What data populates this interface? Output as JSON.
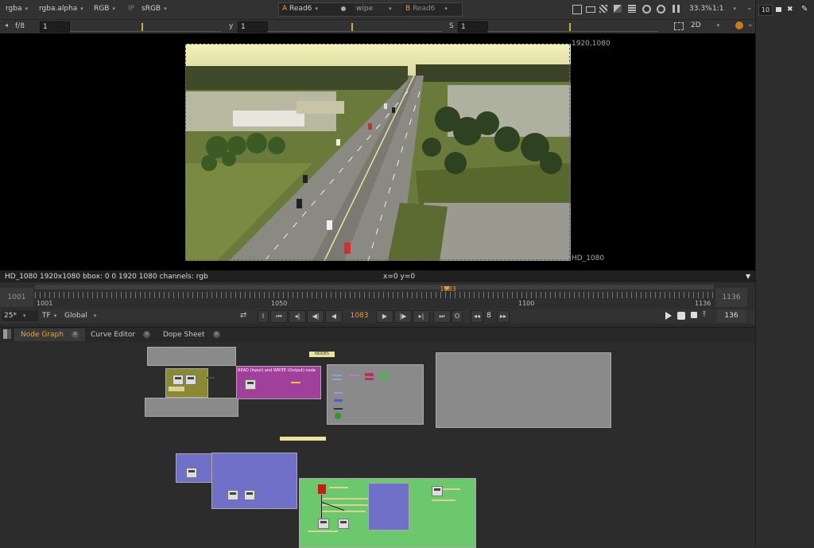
{
  "viewer_toolbar": {
    "channels": "rgba",
    "alpha": "rgba.alpha",
    "display": "RGB",
    "ip": "IP",
    "lut": "sRGB",
    "a_label": "A",
    "a_input": "Read6",
    "wipe_mode": "wipe",
    "b_label": "B",
    "b_input": "Read6",
    "zoom": "33.3%",
    "ratio": "1:1"
  },
  "viewer_toolbar2": {
    "fstop": "f/8",
    "gain": "1",
    "gamma_label": "y",
    "gamma": "1",
    "sat_label": "S",
    "sat": "1",
    "view_mode": "2D",
    "gain_ticks": [
      "0.0625",
      "0.1",
      "0.3",
      "1",
      "3",
      "6",
      "16",
      "64"
    ],
    "gamma_ticks": [
      "0",
      "0.1",
      "0.4",
      "0.5",
      "1",
      "2",
      "4"
    ],
    "sat_ticks": [
      "0",
      "0.1",
      "0.4",
      "0.5",
      "1",
      "2",
      "4"
    ]
  },
  "viewer": {
    "format_top_right": "1920,1080",
    "format_bottom_right": "HD_1080",
    "info_left": "HD_1080 1920x1080  bbox: 0 0 1920 1080 channels: rgb",
    "coords": "x=0 y=0"
  },
  "timeline": {
    "start_frame": "1001",
    "end_frame": "1136",
    "current_frame": "1083",
    "tick_labels": [
      "1001",
      "1050",
      "1100",
      "1136"
    ],
    "current_marker": 0.607
  },
  "playback": {
    "fps": "25*",
    "tf": "TF",
    "range": "Global",
    "frame": "1083",
    "step": "8",
    "end_field": "136"
  },
  "right_panel": {
    "count": "10"
  },
  "tabs": [
    {
      "label": "Node Graph",
      "active": true
    },
    {
      "label": "Curve Editor",
      "active": false
    },
    {
      "label": "Dope Sheet",
      "active": false
    }
  ],
  "node_graph": {
    "nodes_sticky": "NODES",
    "read_write_label": "READ (Input) and WRITE (Output) node"
  },
  "colors": {
    "accent": "#f0a030",
    "backdrop_olive": "#8c8a30",
    "backdrop_purple": "#a0409a",
    "backdrop_blue": "#7070c8",
    "backdrop_green": "#6cc86c",
    "backdrop_gray": "#8a8a8a"
  }
}
